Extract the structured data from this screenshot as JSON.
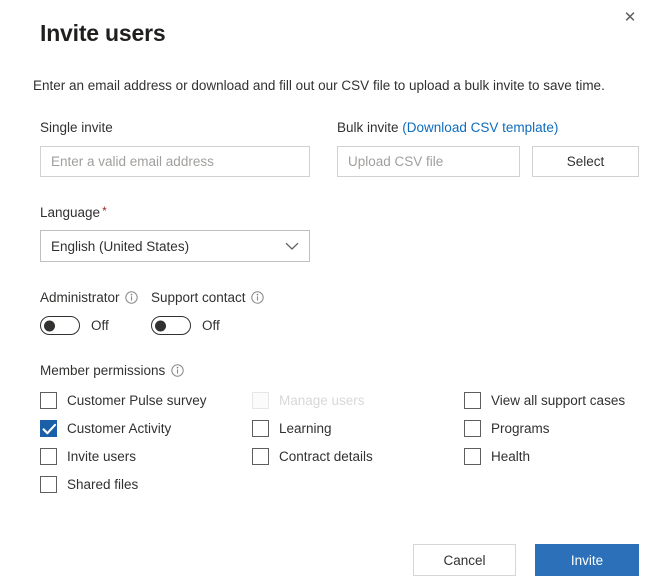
{
  "dialog": {
    "title": "Invite users",
    "subtitle": "Enter an email address or download and fill out our CSV file to upload a bulk invite to save time.",
    "close_icon": "close-icon",
    "close_glyph": "✕"
  },
  "single_invite": {
    "label": "Single invite",
    "email_placeholder": "Enter a valid email address",
    "email_value": ""
  },
  "bulk_invite": {
    "label": "Bulk invite",
    "link_text": "(Download CSV template)",
    "file_placeholder": "Upload CSV file",
    "file_value": "",
    "select_label": "Select"
  },
  "language": {
    "label": "Language",
    "required_marker": "*",
    "selected": "English (United States)",
    "chevron_icon": "chevron-down-icon"
  },
  "toggles": [
    {
      "label": "Administrator",
      "state_text": "Off",
      "checked": false,
      "info_icon": "info-icon"
    },
    {
      "label": "Support contact",
      "state_text": "Off",
      "checked": false,
      "info_icon": "info-icon"
    }
  ],
  "permissions": {
    "header": "Member permissions",
    "info_icon": "info-icon",
    "columns": [
      [
        {
          "label": "Customer Pulse survey",
          "checked": false,
          "disabled": false
        },
        {
          "label": "Customer Activity",
          "checked": true,
          "disabled": false
        },
        {
          "label": "Invite users",
          "checked": false,
          "disabled": false
        },
        {
          "label": "Shared files",
          "checked": false,
          "disabled": false
        }
      ],
      [
        {
          "label": "Manage users",
          "checked": false,
          "disabled": true
        },
        {
          "label": "Learning",
          "checked": false,
          "disabled": false
        },
        {
          "label": "Contract details",
          "checked": false,
          "disabled": false
        }
      ],
      [
        {
          "label": "View all support cases",
          "checked": false,
          "disabled": false
        },
        {
          "label": "Programs",
          "checked": false,
          "disabled": false
        },
        {
          "label": "Health",
          "checked": false,
          "disabled": false
        }
      ]
    ]
  },
  "footer": {
    "cancel_label": "Cancel",
    "invite_label": "Invite"
  },
  "colors": {
    "accent": "#2b70b8",
    "checkbox_checked": "#1b5fa8",
    "link": "#0f6cbd",
    "required": "#a4262c",
    "text": "#323130",
    "placeholder": "#a19f9d",
    "border": "#d1d1d1",
    "disabled_text": "#d8d8d8"
  }
}
